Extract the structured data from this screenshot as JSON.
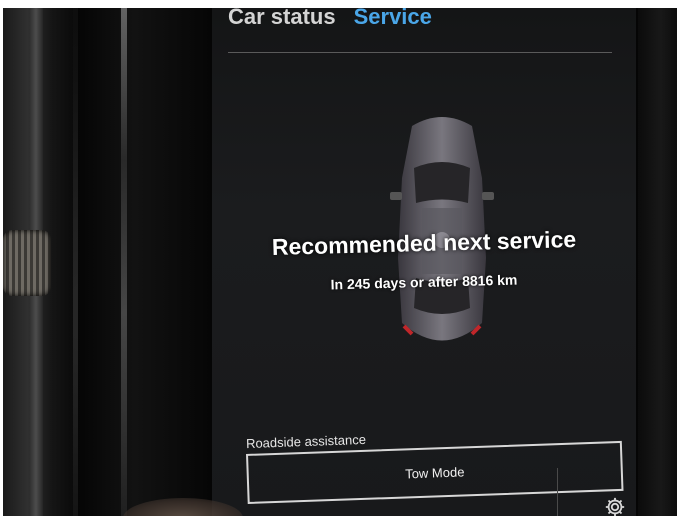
{
  "tabs": {
    "car_status": "Car status",
    "service": "Service"
  },
  "service": {
    "headline": "Recommended next service",
    "detail": "In 245 days or after 8816 km"
  },
  "roadside": {
    "label": "Roadside assistance",
    "tow_mode_label": "Tow Mode"
  },
  "icons": {
    "settings": "gear-icon",
    "car": "car-top-view-icon"
  },
  "colors": {
    "active_tab": "#4aa6e8",
    "inactive_tab": "#d4d4d4",
    "screen_bg": "#1b1c1e",
    "text": "#ffffff"
  }
}
